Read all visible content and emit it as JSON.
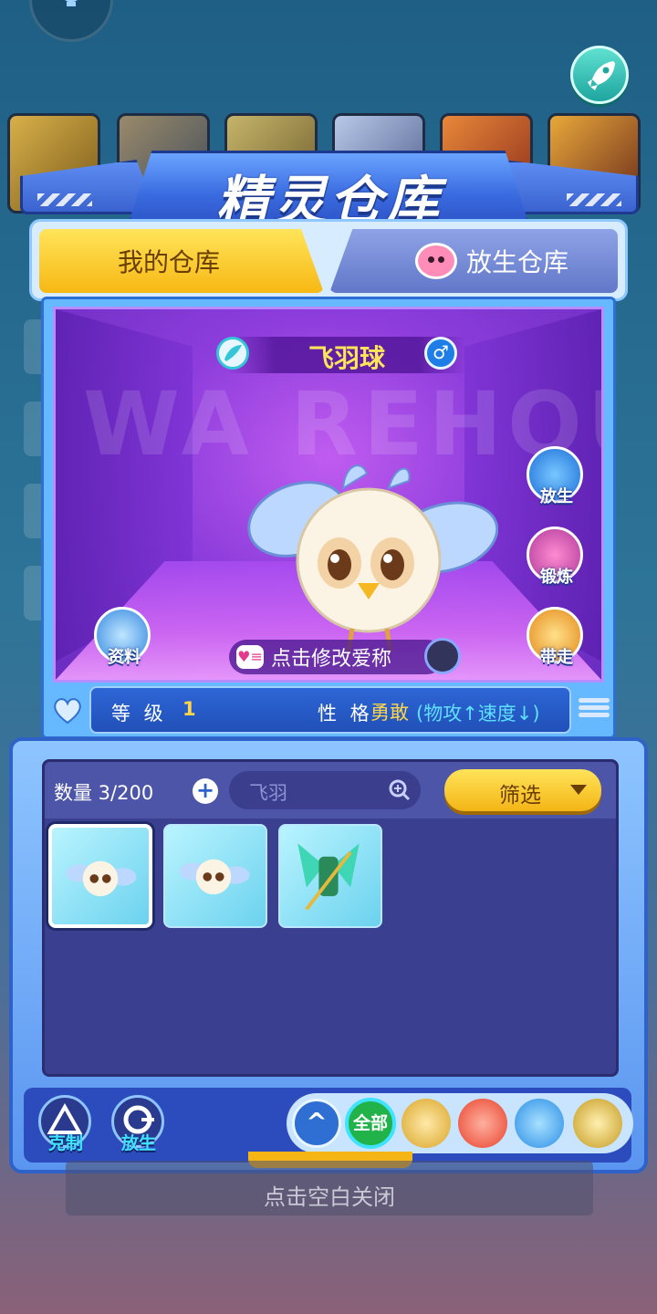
{
  "header": {
    "title": "精灵仓库"
  },
  "tabs": [
    {
      "label": "我的仓库",
      "active": true
    },
    {
      "label": "放生仓库",
      "active": false
    }
  ],
  "stage": {
    "watermark": "WA REHOU SE",
    "pet_name": "飞羽球",
    "gender_symbol": "♂",
    "nickname_hint": "点击修改爱称",
    "actions": {
      "release": "放生",
      "train": "锻炼",
      "carry": "带走",
      "info": "资料"
    }
  },
  "stats": {
    "level_label": "等 级",
    "level_value": "1",
    "nature_label": "性 格",
    "nature_value": "勇敢",
    "nature_effect": "(物攻↑速度↓)"
  },
  "storage": {
    "count": "数量 3/200",
    "search_value": "飞羽",
    "filter_label": "筛选",
    "items": [
      {
        "name": "飞羽球",
        "selected": true
      },
      {
        "name": "飞羽球",
        "selected": false
      },
      {
        "name": "green-armored-spirit",
        "selected": false
      }
    ]
  },
  "bottom": {
    "counter_label": "克制",
    "release_label": "放生",
    "type_filters": {
      "all": "全部",
      "up_arrow": "^"
    }
  },
  "close_hint": "点击空白关闭",
  "colors": {
    "accent_yellow": "#f7b813",
    "panel_blue": "#2f62c9",
    "stage_purple": "#8d3ddc"
  }
}
